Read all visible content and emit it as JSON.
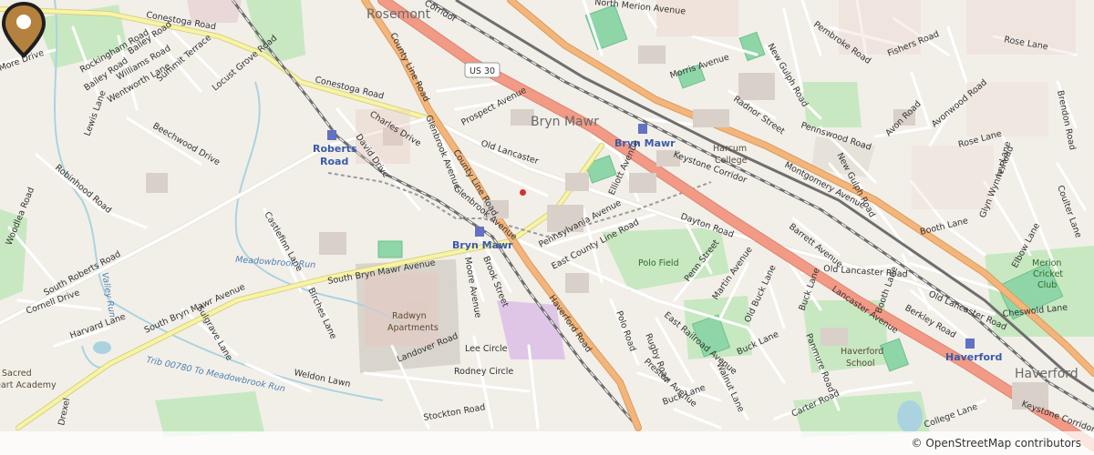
{
  "map": {
    "attribution": "© OpenStreetMap contributors",
    "route_shield": "US 30",
    "colors": {
      "land": "#f2efe9",
      "major_road": "#f3b57a",
      "trunk_road": "#f29a86",
      "secondary_road": "#f7f4a8",
      "railway": "#777777",
      "park": "#c8e8c1",
      "pitch": "#8ed6a7",
      "water": "#aad3df",
      "marker": "#b5813e"
    },
    "places": [
      {
        "key": "rosemont",
        "name": "Rosemont"
      },
      {
        "key": "bryn_mawr",
        "name": "Bryn Mawr"
      },
      {
        "key": "haverford",
        "name": "Haverford"
      }
    ],
    "stations": [
      {
        "key": "roberts_road",
        "line1": "Roberts",
        "line2": "Road"
      },
      {
        "key": "bryn_mawr_r5",
        "name": "Bryn Mawr"
      },
      {
        "key": "bryn_mawr_norristown",
        "name": "Bryn Mawr"
      },
      {
        "key": "haverford",
        "name": "Haverford"
      }
    ],
    "roads": {
      "conestoga_1": "Conestoga Road",
      "conestoga_2": "Conestoga Road",
      "county_line_1": "County Line Road",
      "county_line_2": "County Line Road",
      "haverford_road": "Haverford Road",
      "lancaster_avenue": "Lancaster Avenue",
      "montgomery_avenue": "Montgomery Avenue",
      "south_bryn_mawr_1": "South Bryn Mawr Avenue",
      "south_bryn_mawr_2": "South Bryn Mawr Avenue",
      "south_roberts": "South Roberts Road",
      "old_lancaster_1": "Old Lancaster",
      "old_lancaster_2": "Old Lancaster Road",
      "old_lancaster_3": "Old Lancaster Road",
      "east_county_line": "East County Line Road",
      "pennsylvania_avenue": "Pennsylvania Avenue",
      "glenbrook_1": "Glenbrook Avenue",
      "glenbrook_2": "Glenbrook Avenue",
      "landover": "Landover Road",
      "morris_avenue": "Morris Avenue",
      "merion_avenue": "North Merion Avenue",
      "new_gulph_1": "New Gulph Road",
      "new_gulph_2": "New Gulph Road",
      "pembroke": "Pembroke Road",
      "fishers": "Fishers Road",
      "avon": "Avon Road",
      "avonwood": "Avonwood Road",
      "rose_lane_1": "Rose Lane",
      "rose_lane_2": "Rose Lane",
      "booth_lane": "Booth Lane",
      "booth_lane_2": "Booth Lane",
      "barrett": "Barrett Avenue",
      "dayton": "Dayton Road",
      "penn_street": "Penn Street",
      "martin": "Martin Avenue",
      "old_buck": "Old Buck Lane",
      "buck_lane_1": "Buck Lane",
      "buck_lane_2": "Buck Lane",
      "buck_lane_3": "Buck Lane",
      "east_railroad": "East Railroad Avenue",
      "rugby": "Rugby Road",
      "polo_road": "Polo Road",
      "preston": "Preston Avenue",
      "walnut": "Walnut Lane",
      "panmure": "Panmure Road",
      "carter": "Carter Road",
      "college_lane": "College Lane",
      "berkley": "Berkley Road",
      "cheswold": "Cheswold Lane",
      "elbow": "Elbow Lane",
      "glyn_wynne": "Glyn Wynne Road",
      "ivy": "Ivy Lane",
      "coulter": "Coulter Lane",
      "brendon": "Brendon Road",
      "pennswood": "Pennswood Road",
      "radnor": "Radnor Street",
      "prospect": "Prospect Avenue",
      "charles": "Charles Drive",
      "david": "David Drive",
      "roberts_road_n": "Roberts Road",
      "beechwood": "Beechwood Drive",
      "robinhood": "Robinhood Road",
      "woodlea": "Woodlea Road",
      "cornell": "Cornell Drive",
      "harvard": "Harvard Lane",
      "sulgrave": "Sulgrave Lane",
      "weldon": "Weldon Lawn",
      "lee_circle": "Lee Circle",
      "rodney": "Rodney Circle",
      "stockton": "Stockton Road",
      "moore": "Moore Avenue",
      "brook": "Brook Street",
      "castlefinn": "Castlefinn Lane",
      "birches": "Birches Lane",
      "rockingham": "Rockingham Road",
      "bailey_1": "Bailey Road",
      "bailey_2": "Bailey Road",
      "williams": "Williams Road",
      "summit": "Summit Terrace",
      "wentworth": "Wentworth Lane",
      "lewis": "Lewis Lane",
      "locust_grove": "Locust Grove Road",
      "moore_drive": "More Drive",
      "drexel": "Drexel",
      "elliott": "Elliott Avenue",
      "keystone_1": "Keystone Corridor",
      "keystone_2": "Keystone Corridor",
      "corridor_n": "Corridor"
    },
    "water": {
      "meadowbrook": "Meadowbrook Run",
      "valley_run": "Valley Run",
      "trib": "Trib 00780 To Meadowbrook Run"
    },
    "areas": {
      "polo_field": "Polo Field",
      "radwyn_1": "Radwyn",
      "radwyn_2": "Apartments",
      "harcum_1": "Harcum",
      "harcum_2": "College",
      "haverford_school_1": "Haverford",
      "haverford_school_2": "School",
      "merion_1": "Merion",
      "merion_2": "Cricket",
      "merion_3": "Club",
      "sacred_1": "Sacred",
      "sacred_2": "Heart Academy"
    }
  }
}
